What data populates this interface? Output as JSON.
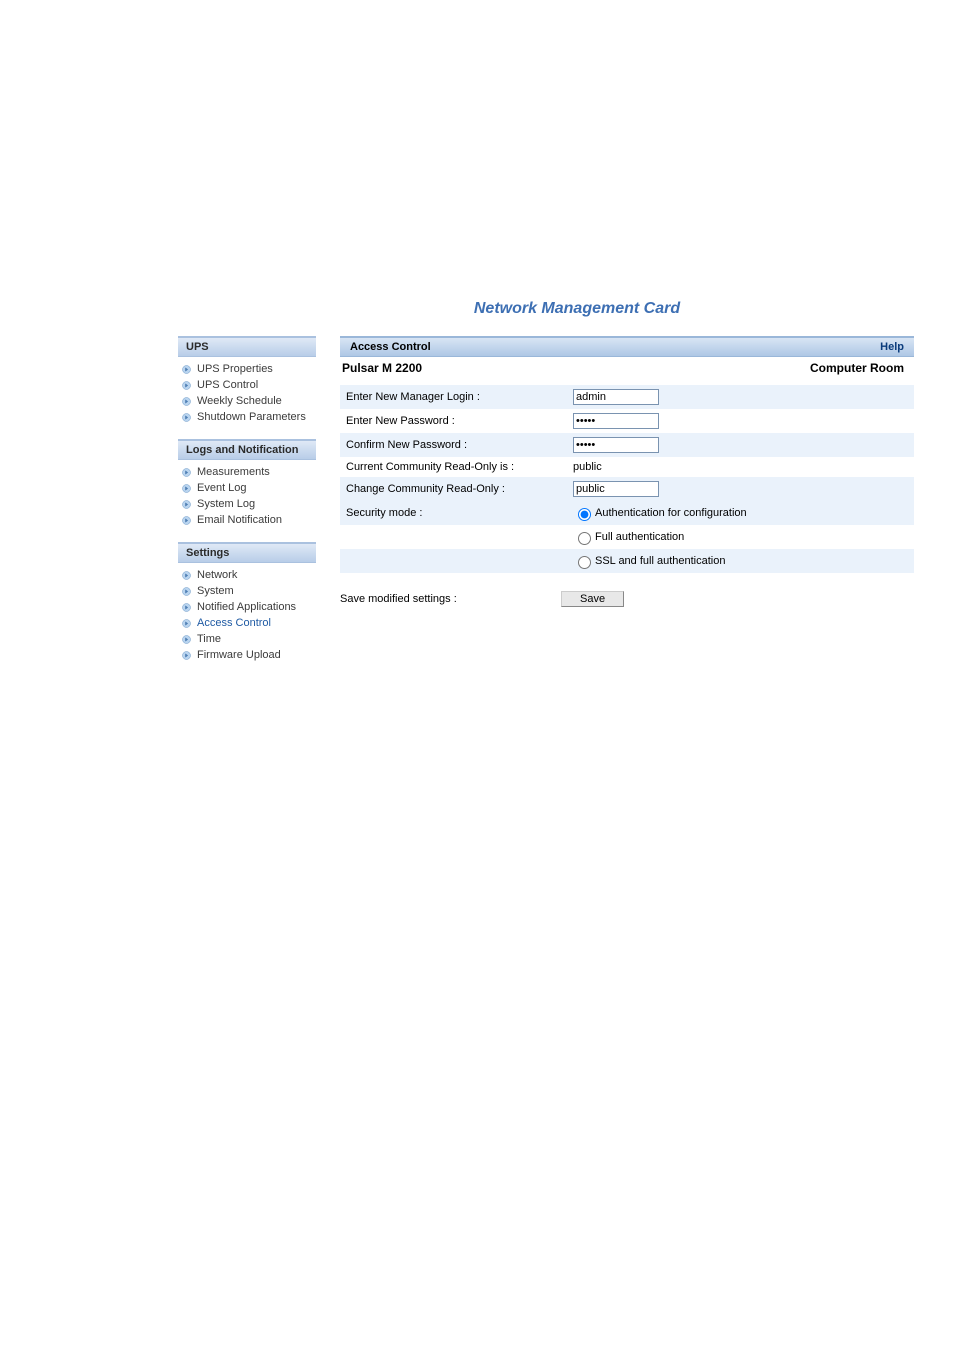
{
  "header": {
    "title": "Network Management Card"
  },
  "sidebar": {
    "sections": [
      {
        "title": "UPS",
        "items": [
          {
            "label": "UPS Properties",
            "active": false
          },
          {
            "label": "UPS Control",
            "active": false
          },
          {
            "label": "Weekly Schedule",
            "active": false
          },
          {
            "label": "Shutdown Parameters",
            "active": false
          }
        ]
      },
      {
        "title": "Logs and Notification",
        "items": [
          {
            "label": "Measurements",
            "active": false
          },
          {
            "label": "Event Log",
            "active": false
          },
          {
            "label": "System Log",
            "active": false
          },
          {
            "label": "Email Notification",
            "active": false
          }
        ]
      },
      {
        "title": "Settings",
        "items": [
          {
            "label": "Network",
            "active": false
          },
          {
            "label": "System",
            "active": false
          },
          {
            "label": "Notified Applications",
            "active": false
          },
          {
            "label": "Access Control",
            "active": true
          },
          {
            "label": "Time",
            "active": false
          },
          {
            "label": "Firmware Upload",
            "active": false
          }
        ]
      }
    ]
  },
  "panel": {
    "title": "Access Control",
    "help": "Help",
    "device": "Pulsar M 2200",
    "location": "Computer Room"
  },
  "form": {
    "rows": [
      {
        "label": "Enter New Manager Login :",
        "type": "text",
        "value": "admin"
      },
      {
        "label": "Enter New Password :",
        "type": "password",
        "value": "•••••"
      },
      {
        "label": "Confirm New Password :",
        "type": "password",
        "value": "•••••"
      },
      {
        "label": "Current Community Read-Only is :",
        "type": "static",
        "value": "public"
      },
      {
        "label": "Change Community Read-Only :",
        "type": "text",
        "value": "public"
      }
    ],
    "security": {
      "label": "Security mode :",
      "options": [
        {
          "label": "Authentication for configuration",
          "checked": true
        },
        {
          "label": "Full authentication",
          "checked": false
        },
        {
          "label": "SSL and full authentication",
          "checked": false
        }
      ]
    },
    "save": {
      "label": "Save modified settings :",
      "button": "Save"
    }
  }
}
